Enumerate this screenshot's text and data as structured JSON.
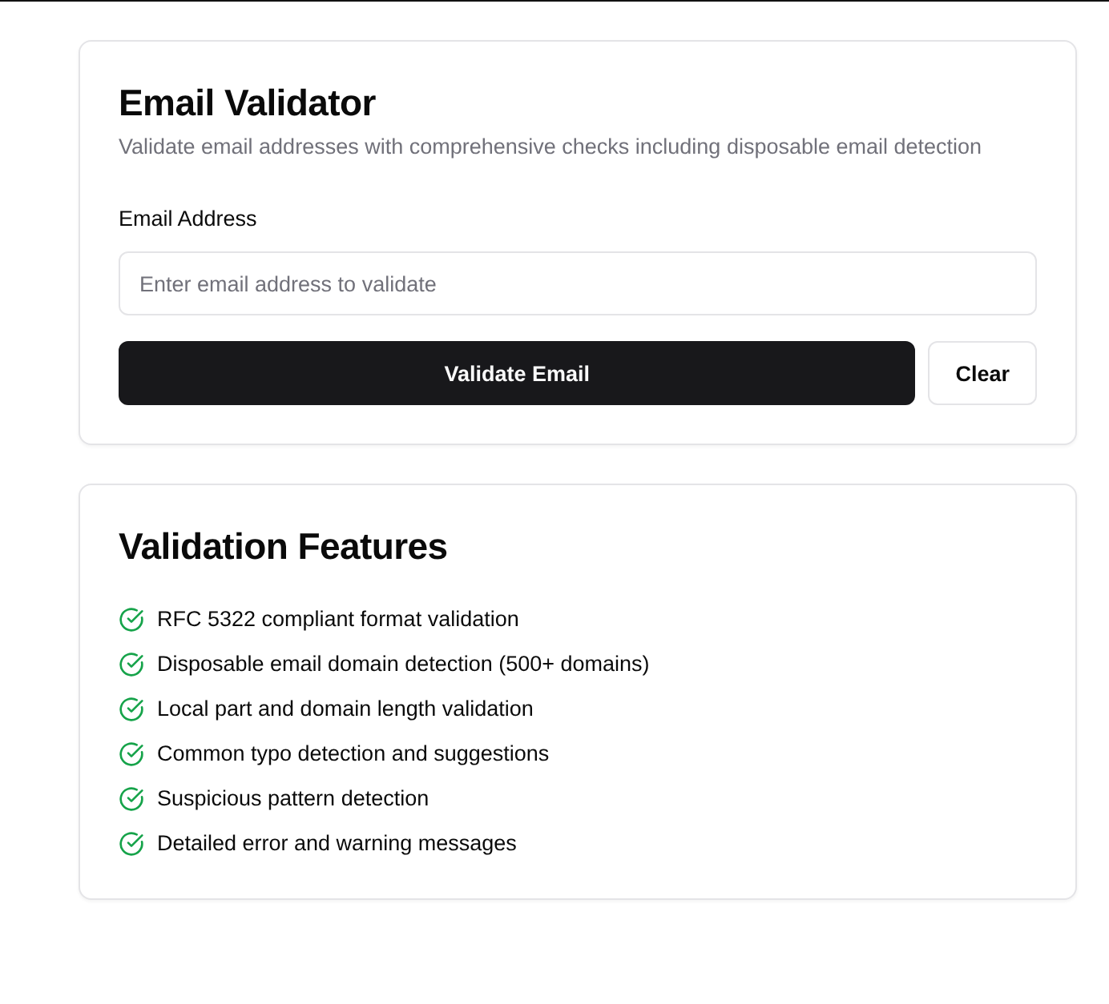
{
  "validator": {
    "title": "Email Validator",
    "description": "Validate email addresses with comprehensive checks including disposable email detection",
    "field_label": "Email Address",
    "placeholder": "Enter email address to validate",
    "buttons": [
      {
        "label": "Validate Email",
        "kind": "primary"
      },
      {
        "label": "Clear",
        "kind": "outline"
      }
    ]
  },
  "features": {
    "title": "Validation Features",
    "items": [
      {
        "label": "RFC 5322 compliant format validation",
        "checked": true
      },
      {
        "label": "Disposable email domain detection (500+ domains)",
        "checked": true
      },
      {
        "label": "Local part and domain length validation",
        "checked": true
      },
      {
        "label": "Common typo detection and suggestions",
        "checked": true
      },
      {
        "label": "Suspicious pattern detection",
        "checked": true
      },
      {
        "label": "Detailed error and warning messages",
        "checked": true
      }
    ]
  }
}
